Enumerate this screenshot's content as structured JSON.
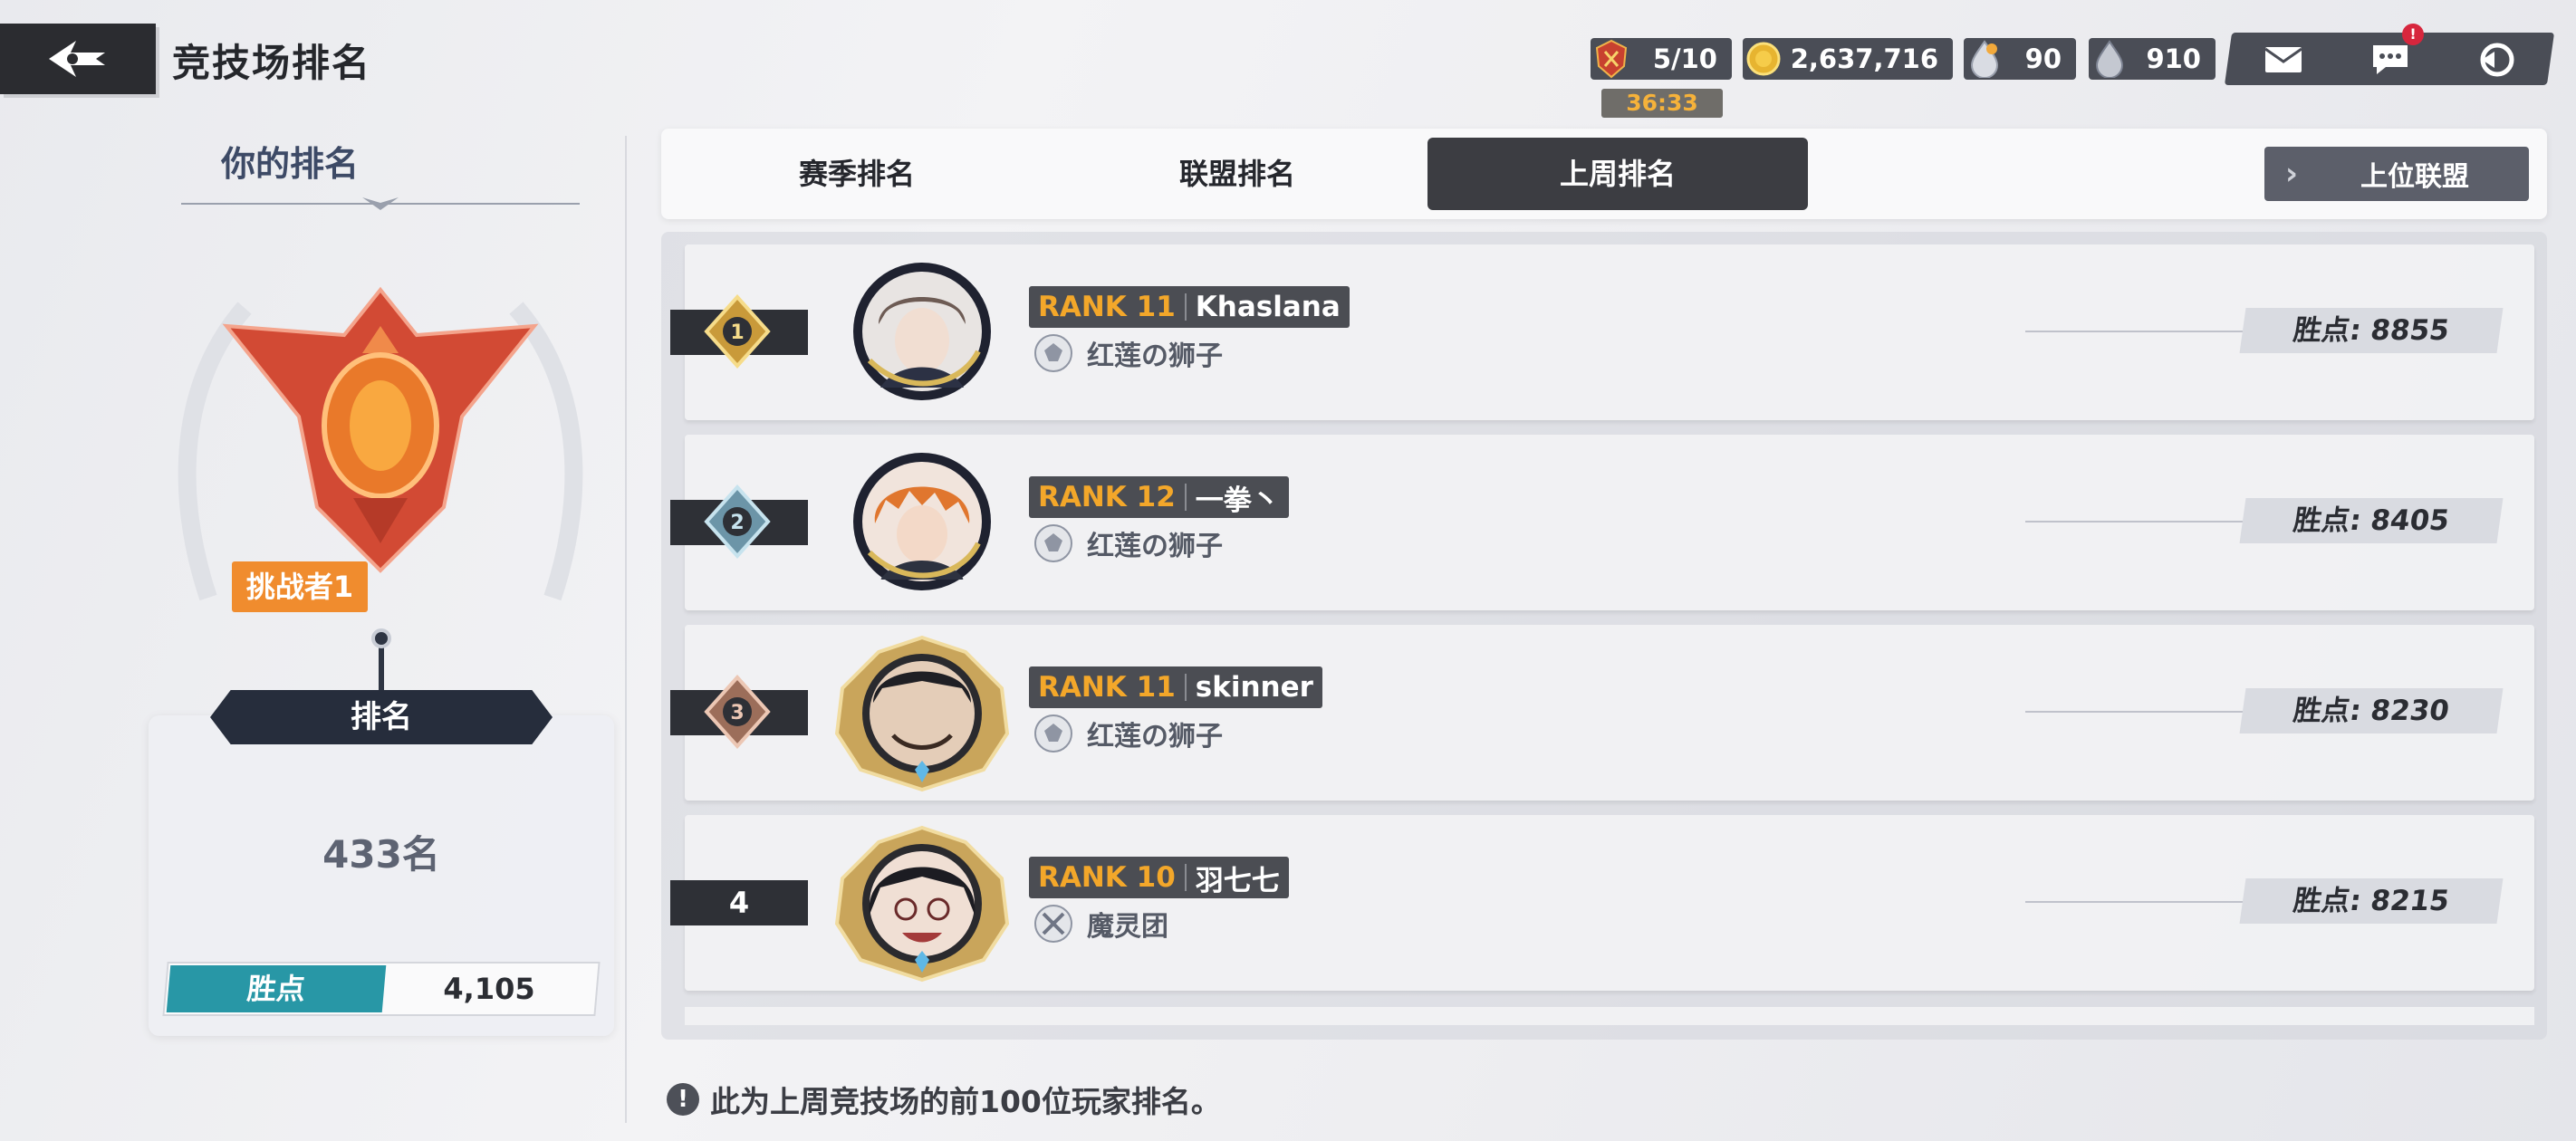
{
  "header": {
    "title": "竞技场排名",
    "resources": [
      {
        "icon": "arena-ticket-icon",
        "value": "5/10"
      },
      {
        "icon": "gold-coin-icon",
        "value": "2,637,716"
      },
      {
        "icon": "mana-drop-icon",
        "value": "90"
      },
      {
        "icon": "water-drop-icon",
        "value": "910"
      }
    ],
    "timer": "36:33",
    "notification_badge": "!"
  },
  "left_panel": {
    "title": "你的排名",
    "tier": "挑战者1",
    "rank_header": "排名",
    "rank_value": "433名",
    "points_label": "胜点",
    "points_value": "4,105"
  },
  "tabs": [
    {
      "label": "赛季排名",
      "active": false
    },
    {
      "label": "联盟排名",
      "active": false
    },
    {
      "label": "上周排名",
      "active": true
    }
  ],
  "upper_league_label": "上位联盟",
  "rows": [
    {
      "rank": "1",
      "level": "RANK 11",
      "name": "Khaslana",
      "guild": "红莲の狮子",
      "score": "胜点: 8855",
      "medal": "gold"
    },
    {
      "rank": "2",
      "level": "RANK 12",
      "name": "一拳丶",
      "guild": "红莲の狮子",
      "score": "胜点: 8405",
      "medal": "blue"
    },
    {
      "rank": "3",
      "level": "RANK 11",
      "name": "skinner",
      "guild": "红莲の狮子",
      "score": "胜点: 8230",
      "medal": "bronze"
    },
    {
      "rank": "4",
      "level": "RANK 10",
      "name": "羽七七",
      "guild": "魔灵团",
      "score": "胜点: 8215",
      "medal": "none"
    }
  ],
  "footer_note": "此为上周竞技场的前100位玩家排名。",
  "colors": {
    "accent_orange": "#f3a72a",
    "points_teal": "#2897a6",
    "tier_orange": "#f08c2e",
    "dark_panel": "#2e3036"
  }
}
